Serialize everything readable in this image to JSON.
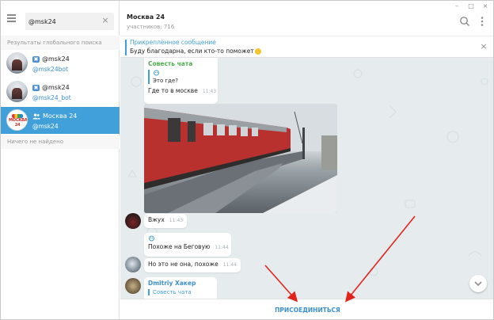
{
  "search": {
    "value": "@msk24",
    "clear_icon": "×"
  },
  "left": {
    "global_results_label": "Результаты глобального поиска",
    "not_found_label": "Ничего не найдено",
    "results": [
      {
        "name": "@msk24",
        "handle": "@msk24bot",
        "type": "bot"
      },
      {
        "name": "@msk24",
        "handle": "@msk24_bot",
        "type": "bot"
      },
      {
        "name": "Москва 24",
        "handle": "@msk24",
        "type": "group",
        "active": true,
        "avatar_text": "МОСКВА 24"
      }
    ]
  },
  "window": {
    "minimize": "–",
    "maximize": "□",
    "close": "×"
  },
  "chat": {
    "title": "Москва 24",
    "subtitle": "участников: 716"
  },
  "pinned": {
    "title": "Прикреплённое сообщение",
    "text": "Буду благодарна, если кто-то поможет"
  },
  "messages": {
    "m1": {
      "sender": "Совесть чата",
      "reply_text": "Это где?",
      "text": "Где то в москве",
      "time": "11:43"
    },
    "m2": {
      "text": "Вжух",
      "time": "11:43"
    },
    "m3": {
      "text": "Похоже на Беговую",
      "time": "11:44"
    },
    "m4": {
      "text": "Но это не она, похоже",
      "time": "11:44"
    },
    "m5": {
      "sender": "Dmitriy Хакер",
      "reply_title": "Совесть чата"
    }
  },
  "bottom": {
    "join_label": "ПРИСОЕДИНИТЬСЯ"
  },
  "colors": {
    "accent": "#419fd9",
    "active_row": "#419fd9",
    "chat_bg": "#e6ebee",
    "arrow": "#e0241b"
  },
  "icons": {
    "menu": "hamburger-icon",
    "search": "search-icon",
    "more": "more-vertical-icon",
    "scroll": "chevron-down-icon"
  }
}
